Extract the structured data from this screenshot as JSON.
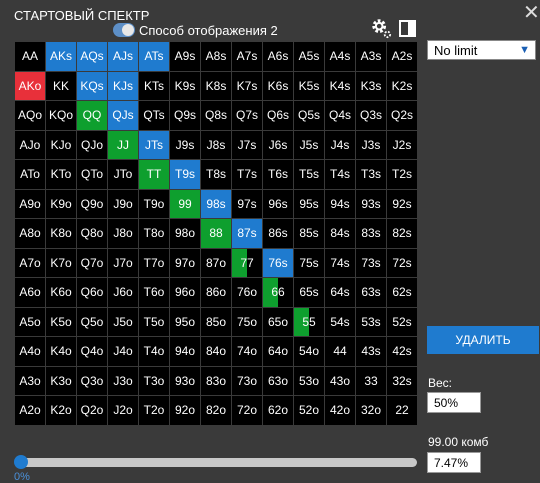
{
  "title": "СТАРТОВЫЙ СПЕКТР",
  "close_icon": "close-icon",
  "mode": {
    "label": "Способ отображения 2",
    "toggle_on": true
  },
  "icons": {
    "settings": "gear-icon",
    "layout": "panel-icon"
  },
  "colors": {
    "raise": "#1f7bcf",
    "call": "#0e9f2e",
    "highlight": "#e8303a",
    "background": "#3a3a3a"
  },
  "grid_rows": [
    [
      {
        "t": "AA"
      },
      {
        "t": "AKs",
        "c": "raise"
      },
      {
        "t": "AQs",
        "c": "raise"
      },
      {
        "t": "AJs",
        "c": "raise"
      },
      {
        "t": "ATs",
        "c": "raise"
      },
      {
        "t": "A9s"
      },
      {
        "t": "A8s"
      },
      {
        "t": "A7s"
      },
      {
        "t": "A6s"
      },
      {
        "t": "A5s"
      },
      {
        "t": "A4s"
      },
      {
        "t": "A3s"
      },
      {
        "t": "A2s"
      }
    ],
    [
      {
        "t": "AKo",
        "c": "highlight"
      },
      {
        "t": "KK"
      },
      {
        "t": "KQs",
        "c": "raise"
      },
      {
        "t": "KJs",
        "c": "raise"
      },
      {
        "t": "KTs"
      },
      {
        "t": "K9s"
      },
      {
        "t": "K8s"
      },
      {
        "t": "K7s"
      },
      {
        "t": "K6s"
      },
      {
        "t": "K5s"
      },
      {
        "t": "K4s"
      },
      {
        "t": "K3s"
      },
      {
        "t": "K2s"
      }
    ],
    [
      {
        "t": "AQo"
      },
      {
        "t": "KQo"
      },
      {
        "t": "QQ",
        "c": "call"
      },
      {
        "t": "QJs",
        "c": "raise"
      },
      {
        "t": "QTs"
      },
      {
        "t": "Q9s"
      },
      {
        "t": "Q8s"
      },
      {
        "t": "Q7s"
      },
      {
        "t": "Q6s"
      },
      {
        "t": "Q5s"
      },
      {
        "t": "Q4s"
      },
      {
        "t": "Q3s"
      },
      {
        "t": "Q2s"
      }
    ],
    [
      {
        "t": "AJo"
      },
      {
        "t": "KJo"
      },
      {
        "t": "QJo"
      },
      {
        "t": "JJ",
        "c": "call"
      },
      {
        "t": "JTs",
        "c": "raise"
      },
      {
        "t": "J9s"
      },
      {
        "t": "J8s"
      },
      {
        "t": "J7s"
      },
      {
        "t": "J6s"
      },
      {
        "t": "J5s"
      },
      {
        "t": "J4s"
      },
      {
        "t": "J3s"
      },
      {
        "t": "J2s"
      }
    ],
    [
      {
        "t": "ATo"
      },
      {
        "t": "KTo"
      },
      {
        "t": "QTo"
      },
      {
        "t": "JTo"
      },
      {
        "t": "TT",
        "c": "call"
      },
      {
        "t": "T9s",
        "c": "raise"
      },
      {
        "t": "T8s"
      },
      {
        "t": "T7s"
      },
      {
        "t": "T6s"
      },
      {
        "t": "T5s"
      },
      {
        "t": "T4s"
      },
      {
        "t": "T3s"
      },
      {
        "t": "T2s"
      }
    ],
    [
      {
        "t": "A9o"
      },
      {
        "t": "K9o"
      },
      {
        "t": "Q9o"
      },
      {
        "t": "J9o"
      },
      {
        "t": "T9o"
      },
      {
        "t": "99",
        "c": "call"
      },
      {
        "t": "98s",
        "c": "raise"
      },
      {
        "t": "97s"
      },
      {
        "t": "96s"
      },
      {
        "t": "95s"
      },
      {
        "t": "94s"
      },
      {
        "t": "93s"
      },
      {
        "t": "92s"
      }
    ],
    [
      {
        "t": "A8o"
      },
      {
        "t": "K8o"
      },
      {
        "t": "Q8o"
      },
      {
        "t": "J8o"
      },
      {
        "t": "T8o"
      },
      {
        "t": "98o"
      },
      {
        "t": "88",
        "c": "call"
      },
      {
        "t": "87s",
        "c": "raise"
      },
      {
        "t": "86s"
      },
      {
        "t": "85s"
      },
      {
        "t": "84s"
      },
      {
        "t": "83s"
      },
      {
        "t": "82s"
      }
    ],
    [
      {
        "t": "A7o"
      },
      {
        "t": "K7o"
      },
      {
        "t": "Q7o"
      },
      {
        "t": "J7o"
      },
      {
        "t": "T7o"
      },
      {
        "t": "97o"
      },
      {
        "t": "87o"
      },
      {
        "t": "77",
        "c": "call",
        "f": 0.5
      },
      {
        "t": "76s",
        "c": "raise"
      },
      {
        "t": "75s"
      },
      {
        "t": "74s"
      },
      {
        "t": "73s"
      },
      {
        "t": "72s"
      }
    ],
    [
      {
        "t": "A6o"
      },
      {
        "t": "K6o"
      },
      {
        "t": "Q6o"
      },
      {
        "t": "J6o"
      },
      {
        "t": "T6o"
      },
      {
        "t": "96o"
      },
      {
        "t": "86o"
      },
      {
        "t": "76o"
      },
      {
        "t": "66",
        "c": "call",
        "f": 0.5
      },
      {
        "t": "65s"
      },
      {
        "t": "64s"
      },
      {
        "t": "63s"
      },
      {
        "t": "62s"
      }
    ],
    [
      {
        "t": "A5o"
      },
      {
        "t": "K5o"
      },
      {
        "t": "Q5o"
      },
      {
        "t": "J5o"
      },
      {
        "t": "T5o"
      },
      {
        "t": "95o"
      },
      {
        "t": "85o"
      },
      {
        "t": "75o"
      },
      {
        "t": "65o"
      },
      {
        "t": "55",
        "c": "call",
        "f": 0.5
      },
      {
        "t": "54s"
      },
      {
        "t": "53s"
      },
      {
        "t": "52s"
      }
    ],
    [
      {
        "t": "A4o"
      },
      {
        "t": "K4o"
      },
      {
        "t": "Q4o"
      },
      {
        "t": "J4o"
      },
      {
        "t": "T4o"
      },
      {
        "t": "94o"
      },
      {
        "t": "84o"
      },
      {
        "t": "74o"
      },
      {
        "t": "64o"
      },
      {
        "t": "54o"
      },
      {
        "t": "44"
      },
      {
        "t": "43s"
      },
      {
        "t": "42s"
      }
    ],
    [
      {
        "t": "A3o"
      },
      {
        "t": "K3o"
      },
      {
        "t": "Q3o"
      },
      {
        "t": "J3o"
      },
      {
        "t": "T3o"
      },
      {
        "t": "93o"
      },
      {
        "t": "83o"
      },
      {
        "t": "73o"
      },
      {
        "t": "63o"
      },
      {
        "t": "53o"
      },
      {
        "t": "43o"
      },
      {
        "t": "33"
      },
      {
        "t": "32s"
      }
    ],
    [
      {
        "t": "A2o"
      },
      {
        "t": "K2o"
      },
      {
        "t": "Q2o"
      },
      {
        "t": "J2o"
      },
      {
        "t": "T2o"
      },
      {
        "t": "92o"
      },
      {
        "t": "82o"
      },
      {
        "t": "72o"
      },
      {
        "t": "62o"
      },
      {
        "t": "52o"
      },
      {
        "t": "42o"
      },
      {
        "t": "32o"
      },
      {
        "t": "22"
      }
    ]
  ],
  "limit_select": {
    "value": "No limit"
  },
  "delete_button": "УДАЛИТЬ",
  "weight": {
    "label": "Вес:",
    "value": "50%"
  },
  "combos": {
    "label": "99.00 комб",
    "value": "7.47%"
  },
  "slider": {
    "value_label": "0%",
    "fraction": 0.0
  }
}
